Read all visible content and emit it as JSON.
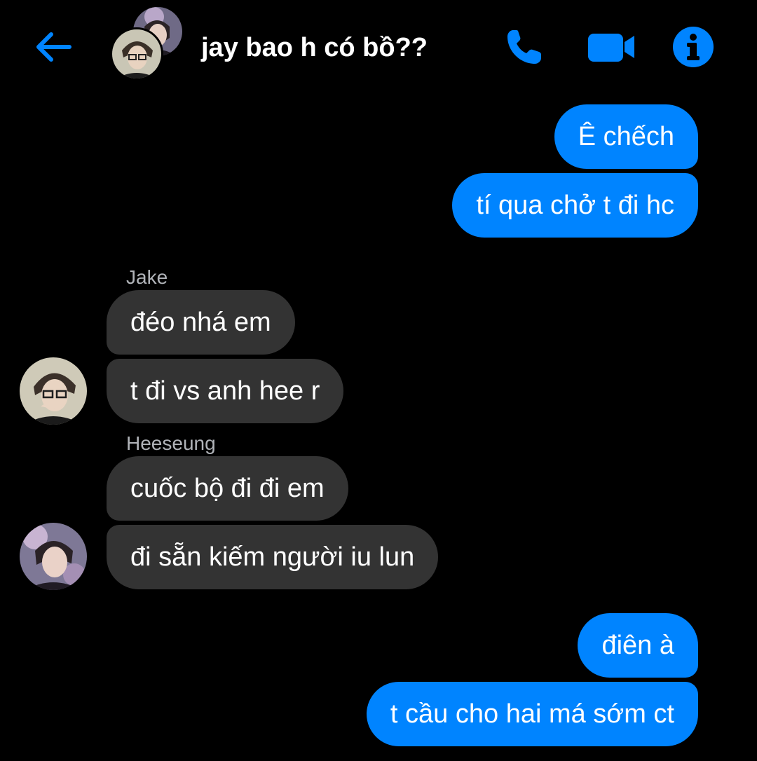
{
  "header": {
    "back_icon": "arrow-left-icon",
    "title": "jay bao h có bồ??",
    "call_icon": "phone-icon",
    "video_icon": "video-camera-icon",
    "info_icon": "info-icon",
    "accent_color": "#0084ff"
  },
  "messages": [
    {
      "direction": "outgoing",
      "text": "Ê chếch"
    },
    {
      "direction": "outgoing",
      "text": "tí qua chở t đi hc"
    },
    {
      "direction": "incoming",
      "sender": "Jake",
      "text": "đéo nhá em"
    },
    {
      "direction": "incoming",
      "sender": "Jake",
      "text": "t đi vs anh hee r"
    },
    {
      "direction": "incoming",
      "sender": "Heeseung",
      "text": "cuốc bộ đi đi em"
    },
    {
      "direction": "incoming",
      "sender": "Heeseung",
      "text": "đi sẵn kiếm người iu lun"
    },
    {
      "direction": "outgoing",
      "text": "điên à"
    },
    {
      "direction": "outgoing",
      "text": "t cầu cho hai má sớm ct"
    }
  ],
  "colors": {
    "background": "#000000",
    "outgoing_bubble": "#0084ff",
    "incoming_bubble": "#333333",
    "sender_name": "#b0b3b8"
  }
}
